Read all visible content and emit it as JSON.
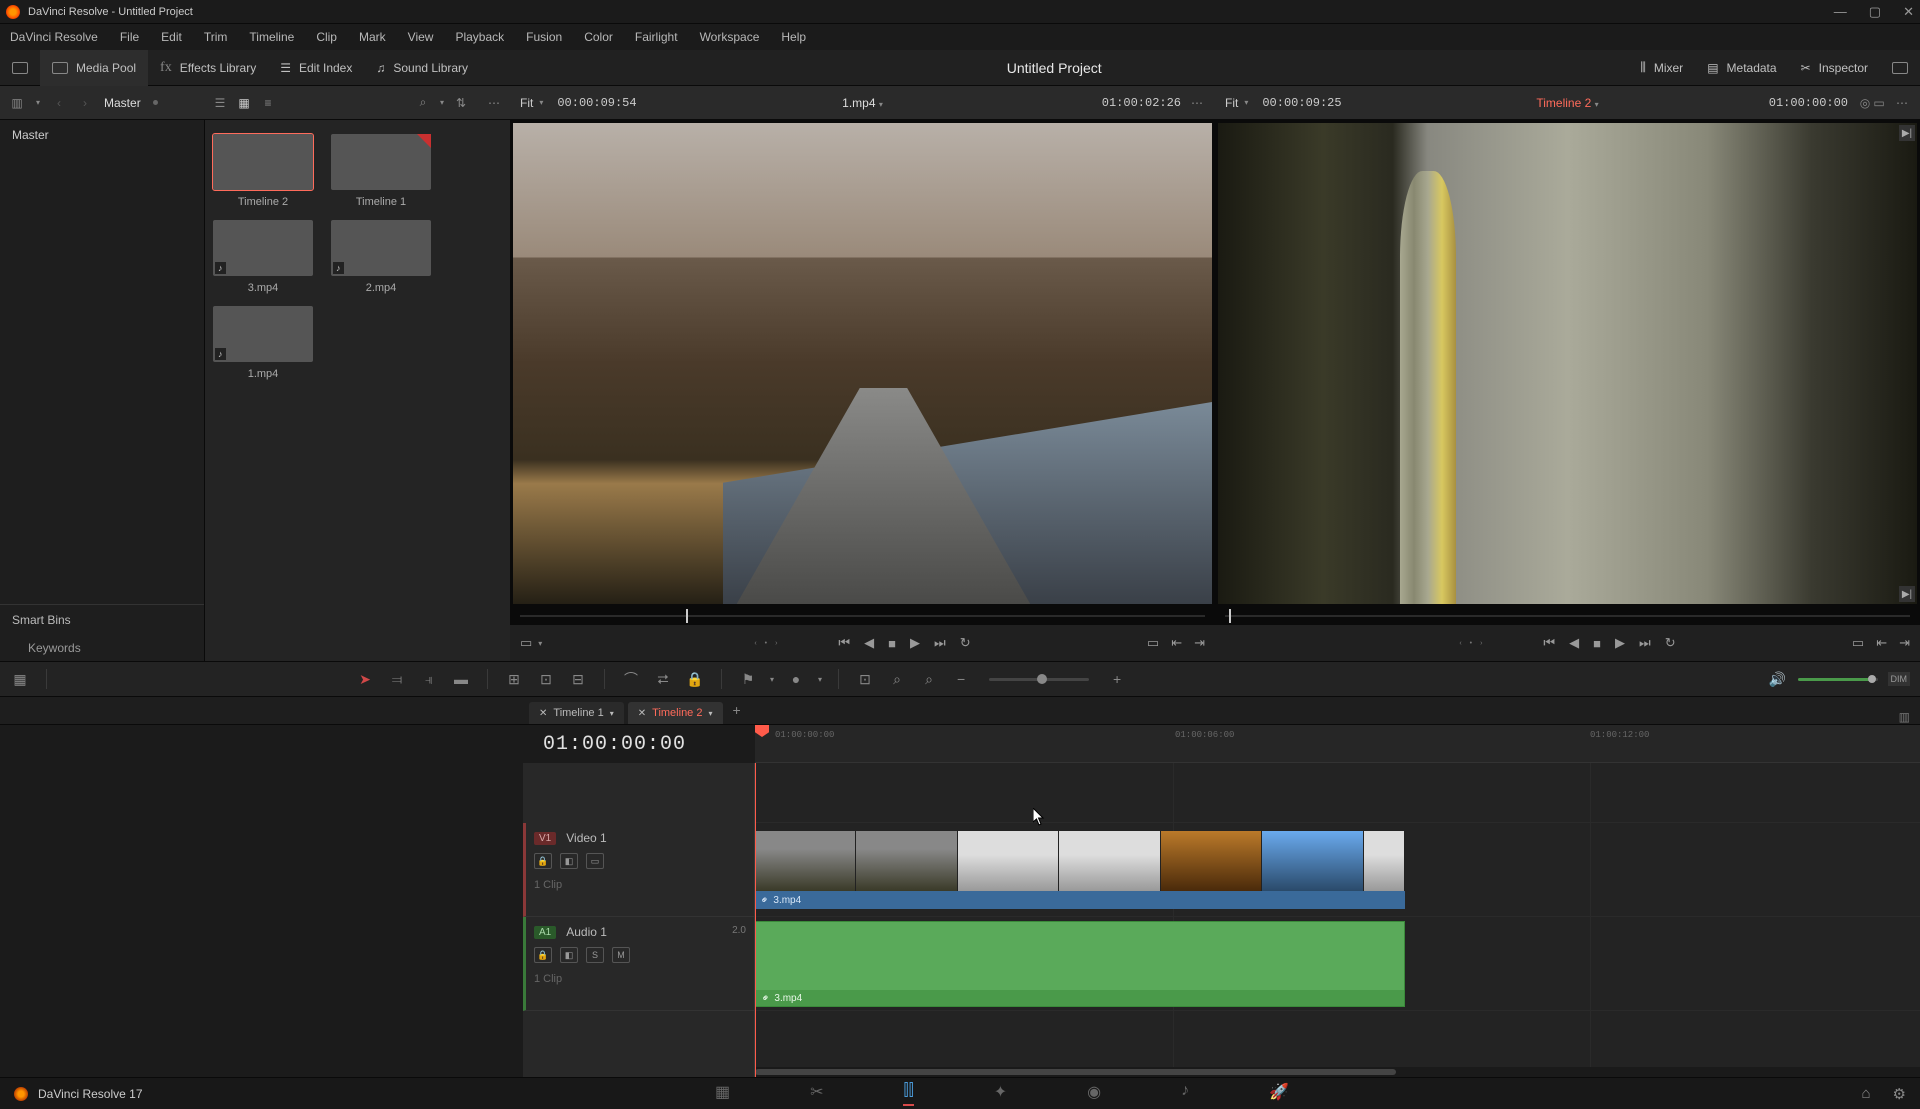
{
  "window": {
    "title": "DaVinci Resolve - Untitled Project"
  },
  "menus": [
    "DaVinci Resolve",
    "File",
    "Edit",
    "Trim",
    "Timeline",
    "Clip",
    "Mark",
    "View",
    "Playback",
    "Fusion",
    "Color",
    "Fairlight",
    "Workspace",
    "Help"
  ],
  "topbar": {
    "mediaPool": "Media Pool",
    "effects": "Effects Library",
    "editIndex": "Edit Index",
    "soundLib": "Sound Library",
    "project": "Untitled Project",
    "mixer": "Mixer",
    "metadata": "Metadata",
    "inspector": "Inspector"
  },
  "controlrow": {
    "master": "Master"
  },
  "source": {
    "fit": "Fit",
    "tc": "00:00:09:54",
    "name": "1.mp4",
    "dur": "01:00:02:26"
  },
  "program": {
    "fit": "Fit",
    "tc": "00:00:09:25",
    "name": "Timeline 2",
    "dur": "01:00:00:00"
  },
  "bins": {
    "master": "Master",
    "smartBins": "Smart Bins",
    "keywords": "Keywords"
  },
  "pool": [
    {
      "label": "Timeline 2",
      "cls": "img-tl2",
      "sel": true,
      "aud": false
    },
    {
      "label": "Timeline 1",
      "cls": "img-tl1",
      "sel": false,
      "aud": false
    },
    {
      "label": "3.mp4",
      "cls": "img-3",
      "sel": false,
      "aud": true
    },
    {
      "label": "2.mp4",
      "cls": "img-2",
      "sel": false,
      "aud": true
    },
    {
      "label": "1.mp4",
      "cls": "img-1",
      "sel": false,
      "aud": true
    }
  ],
  "tabs": [
    {
      "name": "Timeline 1",
      "active": false
    },
    {
      "name": "Timeline 2",
      "active": true
    }
  ],
  "timeline": {
    "tc": "01:00:00:00",
    "video": {
      "tag": "V1",
      "label": "Video 1",
      "clips": "1 Clip"
    },
    "audio": {
      "tag": "A1",
      "label": "Audio 1",
      "clips": "1 Clip",
      "chn": "2.0"
    },
    "clipName": "3.mp4",
    "rulerTicks": [
      "01:00:00:00",
      "01:00:06:00",
      "01:00:12:00"
    ]
  },
  "toolbar": {
    "dim": "DIM"
  },
  "footer": {
    "app": "DaVinci Resolve 17"
  },
  "icons": {
    "s": "S",
    "m": "M"
  }
}
